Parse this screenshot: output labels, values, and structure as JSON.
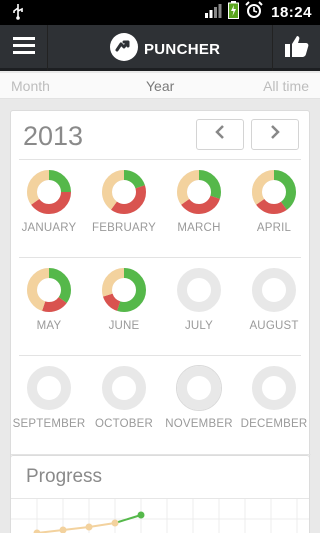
{
  "status": {
    "time": "18:24",
    "battery_color": "#7bc043"
  },
  "app": {
    "name": "PUNCHER"
  },
  "tabs": [
    {
      "label": "Month",
      "active": false
    },
    {
      "label": "Year",
      "active": true
    },
    {
      "label": "All time",
      "active": false
    }
  ],
  "year_panel": {
    "year": "2013"
  },
  "colors": {
    "green": "#55b84a",
    "red": "#d9534f",
    "peach": "#f3d29e",
    "empty": "#e8e8e8"
  },
  "months": [
    {
      "label": "JANUARY",
      "segments": [
        {
          "color": "green",
          "value": 0.25
        },
        {
          "color": "red",
          "value": 0.4
        },
        {
          "color": "peach",
          "value": 0.35
        }
      ]
    },
    {
      "label": "FEBRUARY",
      "segments": [
        {
          "color": "green",
          "value": 0.2
        },
        {
          "color": "red",
          "value": 0.4
        },
        {
          "color": "peach",
          "value": 0.4
        }
      ]
    },
    {
      "label": "MARCH",
      "segments": [
        {
          "color": "green",
          "value": 0.3
        },
        {
          "color": "red",
          "value": 0.35
        },
        {
          "color": "peach",
          "value": 0.35
        }
      ]
    },
    {
      "label": "APRIL",
      "segments": [
        {
          "color": "green",
          "value": 0.4
        },
        {
          "color": "red",
          "value": 0.25
        },
        {
          "color": "peach",
          "value": 0.35
        }
      ]
    },
    {
      "label": "MAY",
      "segments": [
        {
          "color": "green",
          "value": 0.35
        },
        {
          "color": "red",
          "value": 0.2
        },
        {
          "color": "peach",
          "value": 0.45
        }
      ]
    },
    {
      "label": "JUNE",
      "segments": [
        {
          "color": "green",
          "value": 0.55
        },
        {
          "color": "red",
          "value": 0.15
        },
        {
          "color": "peach",
          "value": 0.3
        }
      ]
    },
    {
      "label": "JULY",
      "segments": []
    },
    {
      "label": "AUGUST",
      "segments": []
    },
    {
      "label": "SEPTEMBER",
      "segments": []
    },
    {
      "label": "OCTOBER",
      "segments": []
    },
    {
      "label": "NOVEMBER",
      "segments": [],
      "current": true
    },
    {
      "label": "DECEMBER",
      "segments": []
    }
  ],
  "progress": {
    "title": "Progress",
    "points_color": "#f3d29e",
    "last_point_color": "#55b84a"
  }
}
